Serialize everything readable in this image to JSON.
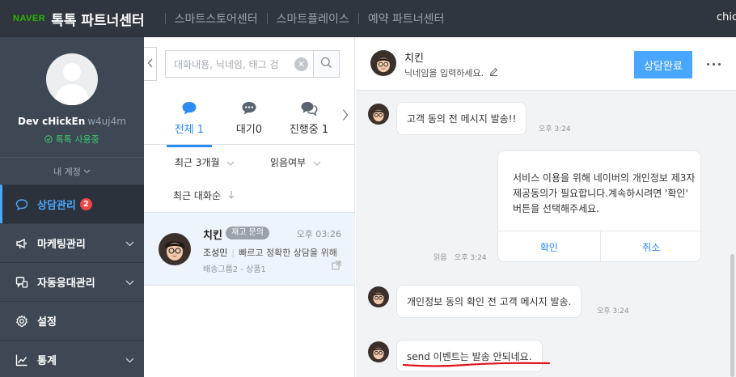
{
  "topbar": {
    "naver": "NAVER",
    "brand": "톡톡 파트너센터",
    "links": [
      "스마트스토어센터",
      "스마트플레이스",
      "예약 파트너센터"
    ],
    "user": "chic"
  },
  "sidebar": {
    "profile_name": "Dev cHickEn",
    "profile_id": "w4uj4m",
    "status": "톡톡 사용중",
    "account": "내 계정",
    "menu": [
      {
        "label": "상담관리",
        "badge": "2",
        "icon": "chat-bubble-icon"
      },
      {
        "label": "마케팅관리",
        "icon": "megaphone-icon"
      },
      {
        "label": "자동응대관리",
        "icon": "auto-reply-icon"
      },
      {
        "label": "설정",
        "icon": "gear-icon"
      },
      {
        "label": "통계",
        "icon": "chart-line-icon"
      }
    ]
  },
  "list": {
    "search_placeholder": "대화내용, 닉네임, 태그 검",
    "tabs": [
      {
        "label": "전체 1",
        "icon": "chat-bubble-blue-icon"
      },
      {
        "label": "대기0",
        "icon": "chat-dots-icon"
      },
      {
        "label": "진행중 1",
        "icon": "chat-multi-icon"
      }
    ],
    "filters": {
      "period": "최근 3개월",
      "read": "읽음여부",
      "sort": "최근 대화순"
    },
    "conversation": {
      "name": "치킨",
      "tag": "재고 문의",
      "time": "오후 03:26",
      "agent": "조성민",
      "preview": "빠르고 정확한 상담을 위해",
      "meta": "배송그룹2 - 상품1"
    }
  },
  "chat": {
    "name": "치킨",
    "nickname_prompt": "닉네임을 입력하세요.",
    "complete_label": "상담완료",
    "messages": [
      {
        "text": "고객 동의 전 메시지 발송!!",
        "time": "오후 3:24"
      },
      {
        "text": "개인정보 동의 확인 전 고객 메시지 발송.",
        "time": "오후 3:24"
      },
      {
        "text": "send 이벤트는 발송 안되네요."
      }
    ],
    "card": {
      "lines": [
        "서비스 이용을 위해 네이버의 개인정보 제3자",
        "제공동의가 필요합니다.계속하시려면 '확인'",
        "버튼을 선택해주세요."
      ],
      "confirm": "확인",
      "cancel": "취소",
      "read": "읽음",
      "time": "오후 3:24"
    }
  }
}
